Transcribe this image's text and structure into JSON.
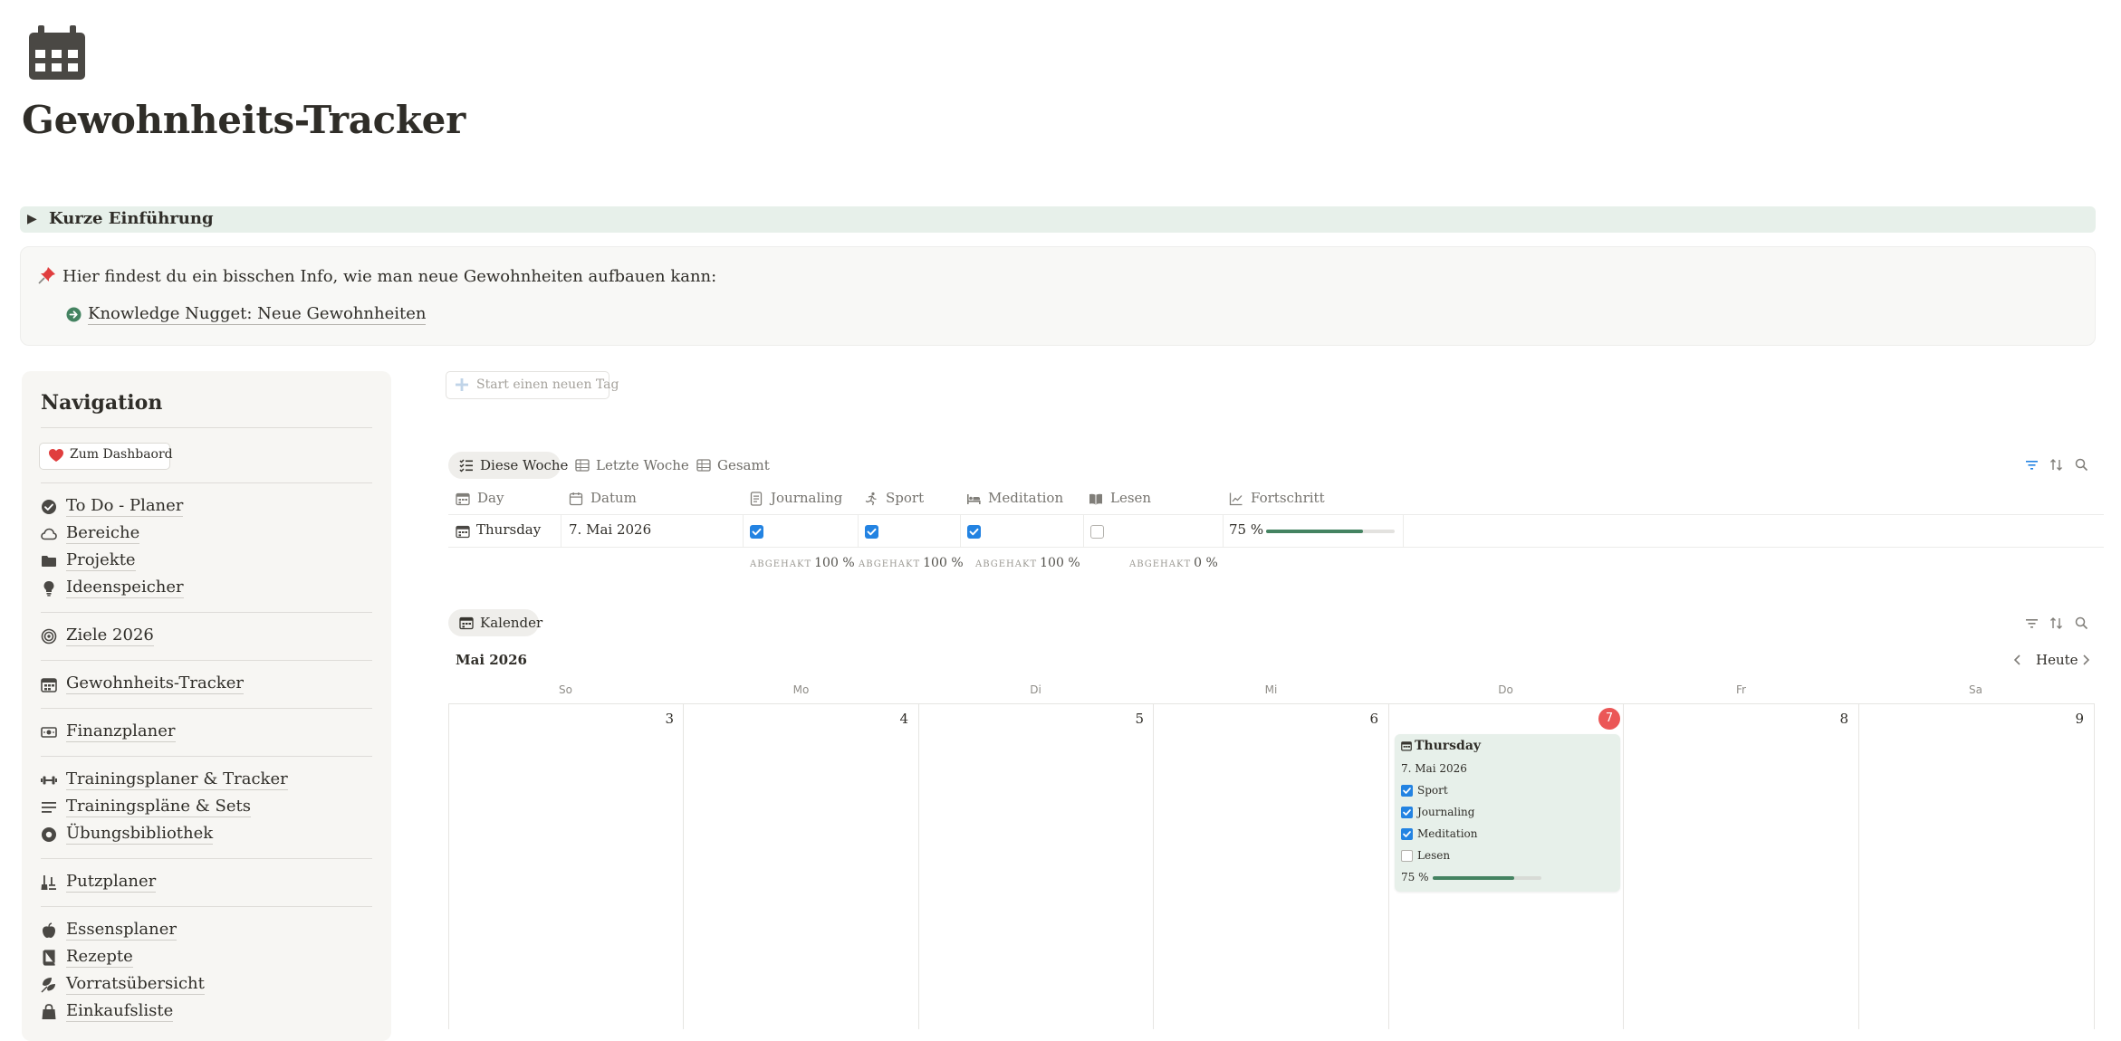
{
  "page": {
    "icon": "calendar-grid-icon",
    "title": "Gewohnheits-Tracker"
  },
  "toggle": {
    "label": "Kurze Einführung"
  },
  "callout": {
    "icon": "pushpin-icon",
    "text": "Hier findest du ein bisschen Info, wie man neue Gewohnheiten aufbauen kann:",
    "link": "Knowledge Nugget: Neue Gewohnheiten"
  },
  "sidebar": {
    "title": "Navigation",
    "dashboard_button": "Zum Dashbaord",
    "items": [
      {
        "label": "To Do - Planer",
        "icon": "check-circle-icon"
      },
      {
        "label": "Bereiche",
        "icon": "cloud-icon"
      },
      {
        "label": "Projekte",
        "icon": "folder-icon"
      },
      {
        "label": "Ideenspeicher",
        "icon": "lightbulb-icon"
      },
      {
        "label": "Ziele 2026",
        "icon": "target-icon"
      },
      {
        "label": "Gewohnheits-Tracker",
        "icon": "calendar-icon"
      },
      {
        "label": "Finanzplaner",
        "icon": "banknote-icon"
      },
      {
        "label": "Trainingsplaner & Tracker",
        "icon": "dumbbell-icon"
      },
      {
        "label": "Trainingspläne & Sets",
        "icon": "lines-icon"
      },
      {
        "label": "Übungsbibliothek",
        "icon": "record-icon"
      },
      {
        "label": "Putzplaner",
        "icon": "broom-icon"
      },
      {
        "label": "Essensplaner",
        "icon": "apple-icon"
      },
      {
        "label": "Rezepte",
        "icon": "book-icon"
      },
      {
        "label": "Vorratsübersicht",
        "icon": "leaves-icon"
      },
      {
        "label": "Einkaufsliste",
        "icon": "shopping-bag-icon"
      }
    ]
  },
  "new_day_button": "Start einen neuen Tag",
  "views": {
    "tabs": [
      "Diese Woche",
      "Letzte Woche",
      "Gesamt"
    ],
    "active": "Diese Woche"
  },
  "table": {
    "columns": [
      "Day",
      "Datum",
      "Journaling",
      "Sport",
      "Meditation",
      "Lesen",
      "Fortschritt"
    ],
    "rows": [
      {
        "day": "Thursday",
        "datum": "7. Mai 2026",
        "journaling": true,
        "sport": true,
        "meditation": true,
        "lesen": false,
        "fortschritt": "75 %",
        "fortschritt_value": 0.75
      }
    ],
    "aggregates": [
      {
        "key": "ABGEHAKT",
        "value": "100 %"
      },
      {
        "key": "ABGEHAKT",
        "value": "100 %"
      },
      {
        "key": "ABGEHAKT",
        "value": "100 %"
      },
      {
        "key": "ABGEHAKT",
        "value": "0 %"
      }
    ]
  },
  "calendar": {
    "tab": "Kalender",
    "month": "Mai 2026",
    "today_button": "Heute",
    "weekdays": [
      "So",
      "Mo",
      "Di",
      "Mi",
      "Do",
      "Fr",
      "Sa"
    ],
    "days": [
      "3",
      "4",
      "5",
      "6",
      "7",
      "8",
      "9"
    ],
    "today": "7",
    "card": {
      "title": "Thursday",
      "date": "7. Mai 2026",
      "habits": [
        {
          "label": "Sport",
          "checked": true
        },
        {
          "label": "Journaling",
          "checked": true
        },
        {
          "label": "Meditation",
          "checked": true
        },
        {
          "label": "Lesen",
          "checked": false
        }
      ],
      "progress": "75 %",
      "progress_value": 0.75
    }
  },
  "colors": {
    "accent_blue": "#2383e2",
    "progress_green": "#448361",
    "today_red": "#eb5757",
    "toggle_bg": "#e7f0ea"
  }
}
